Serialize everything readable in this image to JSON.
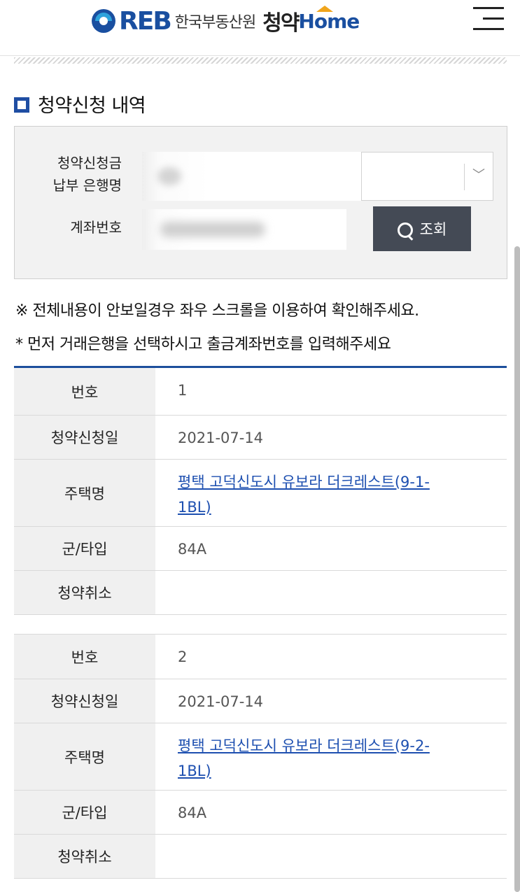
{
  "header": {
    "logo_reb": "REB",
    "logo_org": "한국부동산원",
    "logo_brand": "청약",
    "logo_home": "Home"
  },
  "section": {
    "title": "청약신청 내역"
  },
  "search": {
    "bank_label_line1": "청약신청금",
    "bank_label_line2": "납부 은행명",
    "account_label": "계좌번호",
    "chevron": "﹀",
    "search_button": "조회"
  },
  "notes": {
    "line1": "※ 전체내용이 안보일경우 좌우 스크롤을 이용하여 확인해주세요.",
    "line2": "* 먼저 거래은행을 선택하시고 출금계좌번호를 입력해주세요"
  },
  "columns": {
    "no": "번호",
    "date": "청약신청일",
    "house": "주택명",
    "type": "군/타입",
    "cancel": "청약취소"
  },
  "records": [
    {
      "no": "1",
      "date": "2021-07-14",
      "house_line1": "평택 고덕신도시 유보라 더크레스트(9-1-",
      "house_line2": "1BL)",
      "type": "84A",
      "cancel": ""
    },
    {
      "no": "2",
      "date": "2021-07-14",
      "house_line1": "평택 고덕신도시 유보라 더크레스트(9-2-",
      "house_line2": "1BL)",
      "type": "84A",
      "cancel": ""
    }
  ]
}
